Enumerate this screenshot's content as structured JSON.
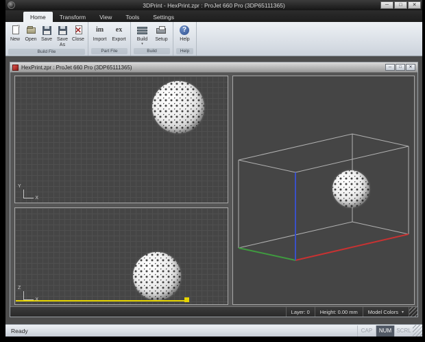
{
  "titlebar": {
    "title": "3DPrint - HexPrint.zpr : ProJet 660 Pro (3DP65111365)",
    "minimize": "─",
    "maximize": "□",
    "close": "✕"
  },
  "tabs": [
    {
      "label": "Home"
    },
    {
      "label": "Transform"
    },
    {
      "label": "View"
    },
    {
      "label": "Tools"
    },
    {
      "label": "Settings"
    }
  ],
  "ribbon": {
    "build_file": {
      "label": "Build File",
      "new": "New",
      "open": "Open",
      "save": "Save",
      "save_as": "Save As",
      "close": "Close"
    },
    "part_file": {
      "label": "Part File",
      "import": "Import",
      "export": "Export",
      "import_glyph": "im",
      "export_glyph": "ex"
    },
    "build": {
      "label": "Build",
      "build": "Build",
      "setup": "Setup",
      "dropdown": "▾"
    },
    "help": {
      "label": "Help",
      "help": "Help",
      "glyph": "?"
    }
  },
  "document": {
    "title": "HexPrint.zpr : ProJet 660 Pro (3DP65111365)",
    "minimize": "─",
    "maximize": "□",
    "close": "✕",
    "status": {
      "layer": "Layer: 0",
      "height": "Height: 0.00 mm",
      "colors": "Model Colors",
      "dropdown": "▾"
    }
  },
  "viewports": {
    "top": {
      "v_axis": "Y",
      "h_axis": "X"
    },
    "front": {
      "v_axis": "Z",
      "h_axis": "X"
    }
  },
  "statusbar": {
    "ready": "Ready",
    "cap": "CAP",
    "num": "NUM",
    "scrl": "SCRL"
  },
  "colors": {
    "axis_x": "#c83232",
    "axis_y": "#3f9b3f",
    "axis_z": "#3a50c8",
    "wireframe": "#b2b2b2",
    "bed_highlight": "#e6d400"
  }
}
